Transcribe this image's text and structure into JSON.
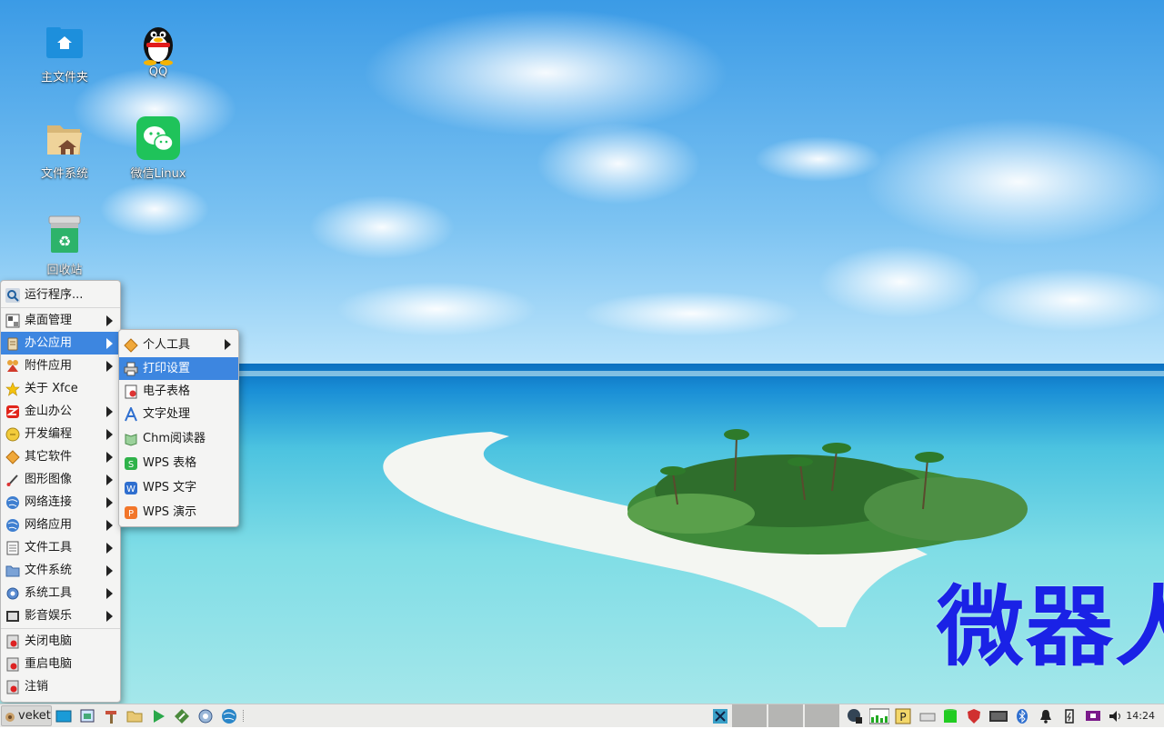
{
  "desktop": {
    "icons": [
      {
        "label": "主文件夹",
        "icon": "home-folder-icon"
      },
      {
        "label": "QQ",
        "icon": "qq-penguin-icon"
      },
      {
        "label": "文件系统",
        "icon": "filesystem-folder-icon"
      },
      {
        "label": "微信Linux",
        "icon": "wechat-icon"
      },
      {
        "label": "回收站",
        "icon": "trash-icon"
      }
    ],
    "watermark": "微器人"
  },
  "start_menu": {
    "items": [
      {
        "label": "运行程序...",
        "icon": "search-icon"
      },
      {
        "label": "桌面管理",
        "icon": "desktop-settings-icon",
        "submenu": true
      },
      {
        "label": "办公应用",
        "icon": "office-icon",
        "submenu": true,
        "selected": true
      },
      {
        "label": "附件应用",
        "icon": "accessories-icon",
        "submenu": true
      },
      {
        "label": "关于 Xfce",
        "icon": "star-icon"
      },
      {
        "label": "金山办公",
        "icon": "wps-icon",
        "submenu": true
      },
      {
        "label": "开发编程",
        "icon": "development-icon",
        "submenu": true
      },
      {
        "label": "其它软件",
        "icon": "other-software-icon",
        "submenu": true
      },
      {
        "label": "图形图像",
        "icon": "graphics-icon",
        "submenu": true
      },
      {
        "label": "网络连接",
        "icon": "network-icon",
        "submenu": true
      },
      {
        "label": "网络应用",
        "icon": "internet-icon",
        "submenu": true
      },
      {
        "label": "文件工具",
        "icon": "file-tools-icon",
        "submenu": true
      },
      {
        "label": "文件系统",
        "icon": "folder-icon",
        "submenu": true
      },
      {
        "label": "系统工具",
        "icon": "system-tools-icon",
        "submenu": true
      },
      {
        "label": "影音娱乐",
        "icon": "multimedia-icon",
        "submenu": true
      },
      {
        "label": "关闭电脑",
        "icon": "shutdown-icon"
      },
      {
        "label": "重启电脑",
        "icon": "reboot-icon"
      },
      {
        "label": "注销",
        "icon": "logout-icon"
      }
    ]
  },
  "office_submenu": {
    "items": [
      {
        "label": "个人工具",
        "icon": "personal-tools-icon",
        "submenu": true
      },
      {
        "label": "打印设置",
        "icon": "printer-icon",
        "selected": true
      },
      {
        "label": "电子表格",
        "icon": "spreadsheet-icon"
      },
      {
        "label": "文字处理",
        "icon": "word-processor-icon"
      },
      {
        "label": "Chm阅读器",
        "icon": "chm-reader-icon"
      },
      {
        "label": "WPS 表格",
        "icon": "wps-spreadsheet-icon"
      },
      {
        "label": "WPS 文字",
        "icon": "wps-writer-icon"
      },
      {
        "label": "WPS 演示",
        "icon": "wps-presentation-icon"
      }
    ]
  },
  "taskbar": {
    "start_label": "veket",
    "launchers": [
      "desktop-icon",
      "screenshot-icon",
      "hammer-icon",
      "folder-icon",
      "media-player-icon",
      "editor-icon",
      "settings-icon",
      "browser-icon"
    ],
    "tray": [
      "network-status-icon",
      "cpu-meter-icon",
      "parking-icon",
      "drive-icon",
      "battery-green-icon",
      "shield-icon",
      "keyboard-icon",
      "bluetooth-icon",
      "notification-bell-icon",
      "power-icon",
      "screen-icon",
      "volume-icon"
    ],
    "clock": "14:24"
  },
  "colors": {
    "menu_highlight": "#3d86e0",
    "watermark": "#1a22e6",
    "menu_bg": "#f4f4f3"
  }
}
